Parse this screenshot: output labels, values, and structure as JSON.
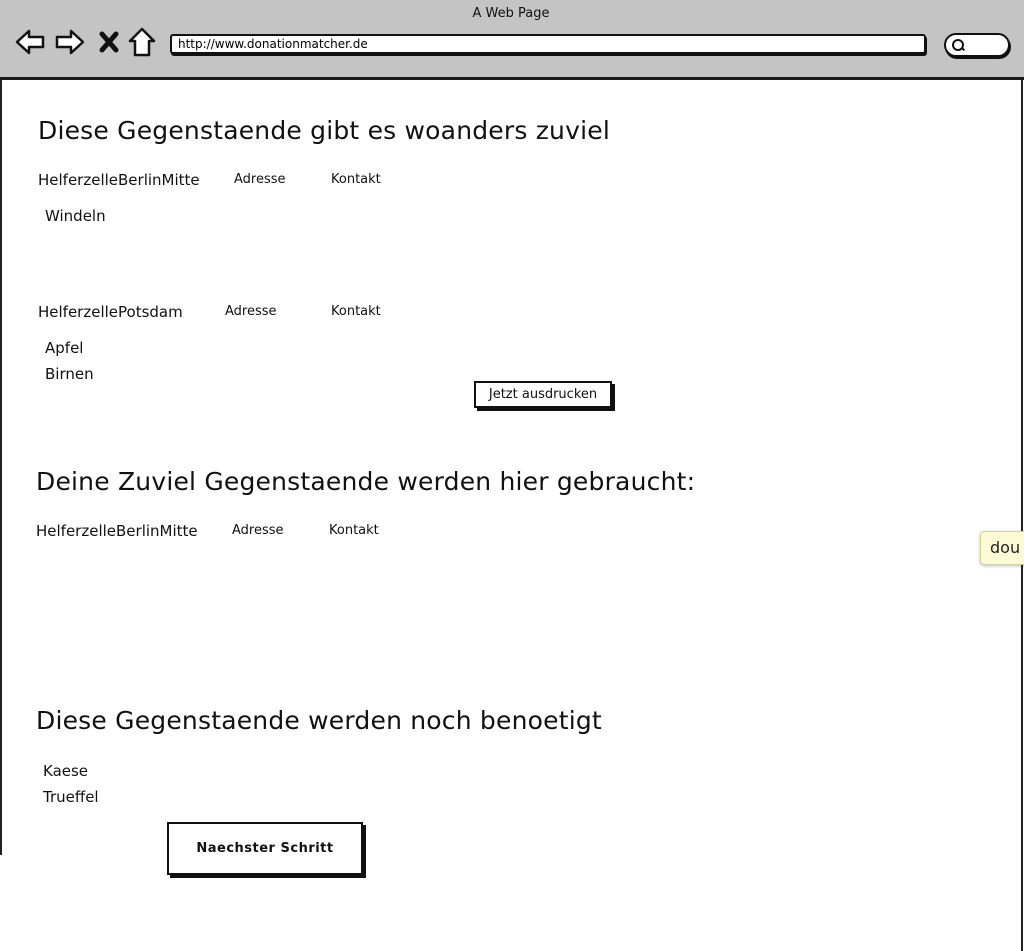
{
  "window": {
    "title": "A Web Page",
    "url": "http://www.donationmatcher.de"
  },
  "icons": {
    "back": "back-arrow-icon",
    "forward": "forward-arrow-icon",
    "stop": "close-icon",
    "home": "home-icon",
    "search": "search-icon"
  },
  "section_surplus": {
    "heading": "Diese Gegenstaende gibt es woanders zuviel",
    "groups": [
      {
        "name": "HelferzelleBerlinMitte",
        "address_label": "Adresse",
        "contact_label": "Kontakt",
        "items": [
          "Windeln"
        ]
      },
      {
        "name": "HelferzellePotsdam",
        "address_label": "Adresse",
        "contact_label": "Kontakt",
        "items": [
          "Apfel",
          "Birnen"
        ]
      }
    ],
    "print_button": "Jetzt ausdrucken"
  },
  "section_needed_elsewhere": {
    "heading": "Deine Zuviel Gegenstaende werden hier gebraucht:",
    "groups": [
      {
        "name": "HelferzelleBerlinMitte",
        "address_label": "Adresse",
        "contact_label": "Kontakt"
      }
    ]
  },
  "section_still_needed": {
    "heading": "Diese Gegenstaende werden noch benoetigt",
    "items": [
      "Kaese",
      "Trueffel"
    ],
    "next_button": "Naechster Schritt"
  },
  "side_note": {
    "text": "dou"
  },
  "colors": {
    "chrome_background": "#c4c4c4",
    "page_background": "#ffffff",
    "ink": "#111111",
    "note_background": "#fdfbd6"
  }
}
